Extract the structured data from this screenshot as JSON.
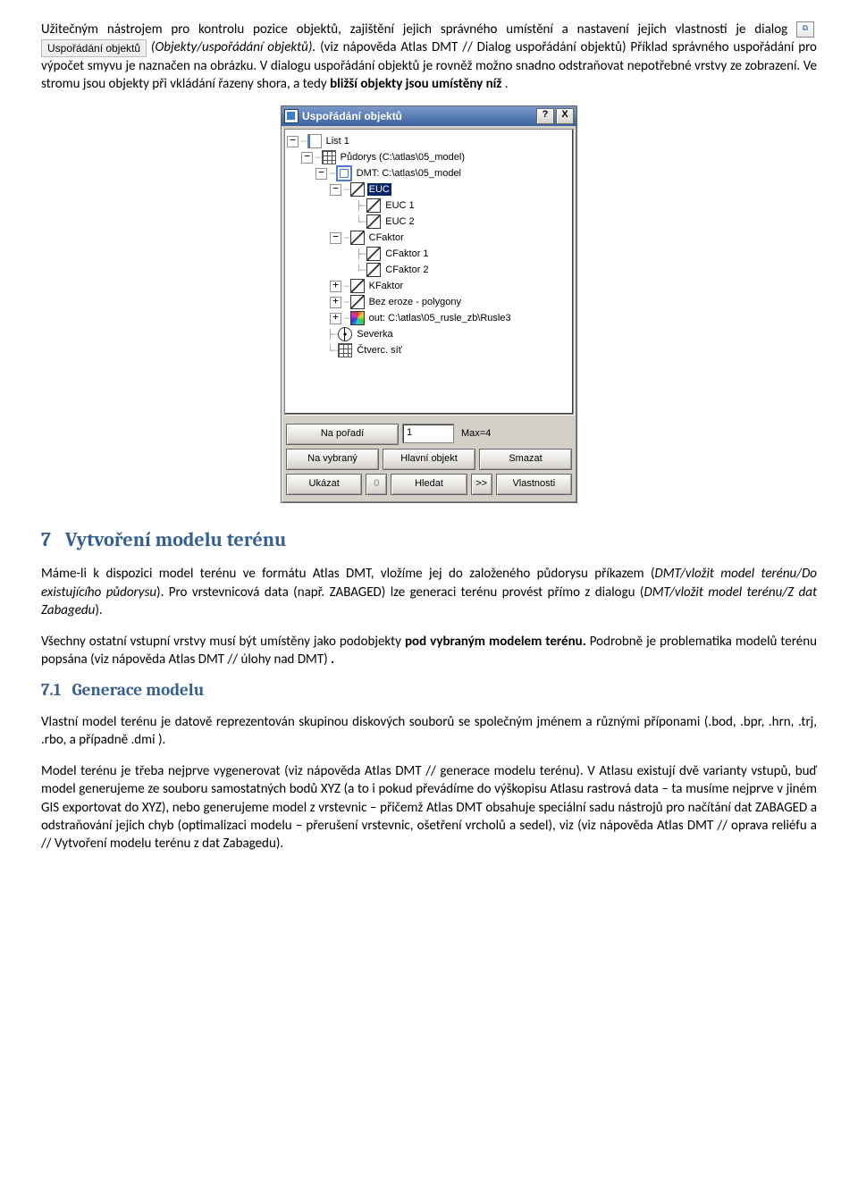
{
  "para1_a": "Užitečným nástrojem pro kontrolu pozice objektů, zajištění jejich správného umístění a nastavení jejich vlastností je dialog ",
  "inline_btn_label": "Uspořádání objektů",
  "para1_b": " (Objekty/uspořádání objektů).",
  "para1_c": " (viz nápověda Atlas DMT // Dialog uspořádání objektů) Příklad správného uspořádání pro výpočet smyvu je naznačen na obrázku. V dialogu uspořádání objektů je rovněž možno snadno odstraňovat nepotřebné vrstvy ze zobrazení. Ve stromu jsou objekty při vkládání řazeny shora, a tedy ",
  "para1_d_bold": "bližší objekty jsou umístěny níž",
  "para1_e": ".",
  "dialog": {
    "title": "Uspořádání objektů",
    "help": "?",
    "close": "X",
    "tree": {
      "list": "List 1",
      "pud": "Půdorys (C:\\atlas\\05_model)",
      "dmt": "DMT: C:\\atlas\\05_model",
      "n1": "EUC",
      "n2": "EUC 1",
      "n3": "EUC 2",
      "n4": "CFaktor",
      "n5": "CFaktor 1",
      "n6": "CFaktor 2",
      "n7": "KFaktor",
      "n8": "Bez eroze - polygony",
      "n9": "out: C:\\atlas\\05_rusle_zb\\Rusle3",
      "n10": "Severka",
      "n11": "Čtverc. síť"
    },
    "btns": {
      "na_poradi": "Na pořadí",
      "order_val": "1",
      "max": "Max=4",
      "na_vybrany": "Na vybraný",
      "hlavni": "Hlavní objekt",
      "smazat": "Smazat",
      "ukazat": "Ukázat",
      "zero": "0",
      "hledat": "Hledat",
      "fwd": ">>",
      "vlastnosti": "Vlastnosti"
    }
  },
  "sec7_num": "7",
  "sec7_title": "Vytvoření modelu terénu",
  "sec7_p1": "Máme-li k dispozici model terénu ve formátu Atlas DMT, vložíme jej do založeného půdorysu příkazem (DMT/vložit model terénu/Do existujícího půdorysu). Pro vrstevnicová data (např. ZABAGED) lze generaci terénu provést přímo z dialogu (DMT/vložit model terénu/Z dat Zabagedu).",
  "sec7_p2a": "Všechny ostatní vstupní vrstvy musí být umístěny jako podobjekty ",
  "sec7_p2b_bold": "pod vybraným modelem terénu.",
  "sec7_p2c": " Podrobně je problematika modelů terénu popsána (viz nápověda Atlas DMT // úlohy nad DMT)",
  "sec7_p2d_bold": ".",
  "sec71_num": "7.1",
  "sec71_title": "Generace modelu",
  "sec71_p1": "Vlastní model terénu je datově reprezentován skupinou diskových souborů se společným jménem a různými příponami (.bod, .bpr, .hrn, .trj, .rbo, a případně .dmi ).",
  "sec71_p2": "Model terénu je třeba nejprve vygenerovat (viz nápověda Atlas DMT // generace modelu terénu). V Atlasu existují dvě varianty vstupů, buď model generujeme ze souboru samostatných bodů XYZ (a to i pokud převádíme do výškopisu Atlasu rastrová data – ta musíme nejprve v jiném GIS exportovat do XYZ), nebo generujeme model z vrstevnic – přičemž Atlas DMT obsahuje speciální sadu nástrojů pro načítání dat ZABAGED a odstraňování jejich chyb (optimalizaci modelu – přerušení vrstevnic, ošetření vrcholů a sedel), viz (viz nápověda Atlas DMT // oprava reliéfu a // Vytvoření modelu terénu z dat Zabagedu)."
}
